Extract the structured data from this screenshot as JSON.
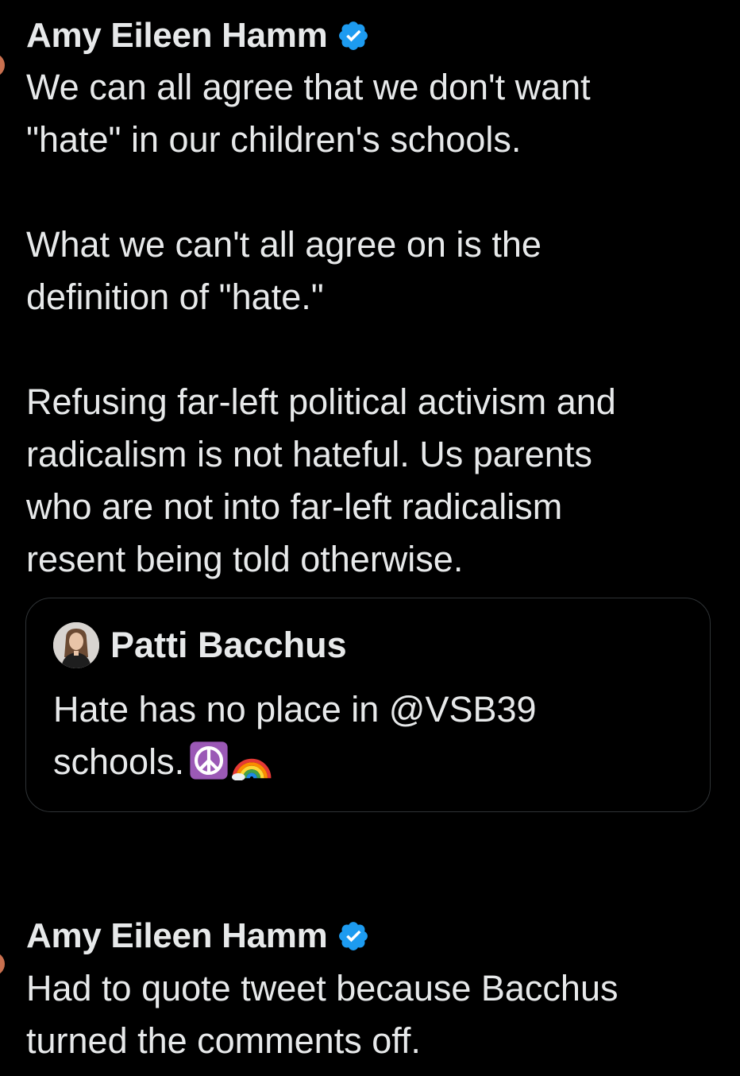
{
  "tweets": [
    {
      "author": "Amy Eileen Hamm",
      "verified": true,
      "paragraphs": [
        "We can all agree that we don't want\n\"hate\" in our children's schools.",
        "What we can't all agree on is the\ndefinition of \"hate.\"",
        "Refusing far-left political activism and\nradicalism is not hateful. Us parents\nwho are not into far-left radicalism\nresent being told otherwise."
      ],
      "quote": {
        "author": "Patti Bacchus",
        "text": "Hate has no place in @VSB39\nschools.",
        "emojis": [
          "peace-symbol-icon",
          "rainbow-icon"
        ]
      }
    },
    {
      "author": "Amy Eileen Hamm",
      "verified": true,
      "paragraphs": [
        "Had to quote tweet because Bacchus\nturned the comments off."
      ]
    }
  ],
  "colors": {
    "background": "#000000",
    "text": "#e7e9ea",
    "verified": "#1d9bf0",
    "border": "#2f3336"
  }
}
